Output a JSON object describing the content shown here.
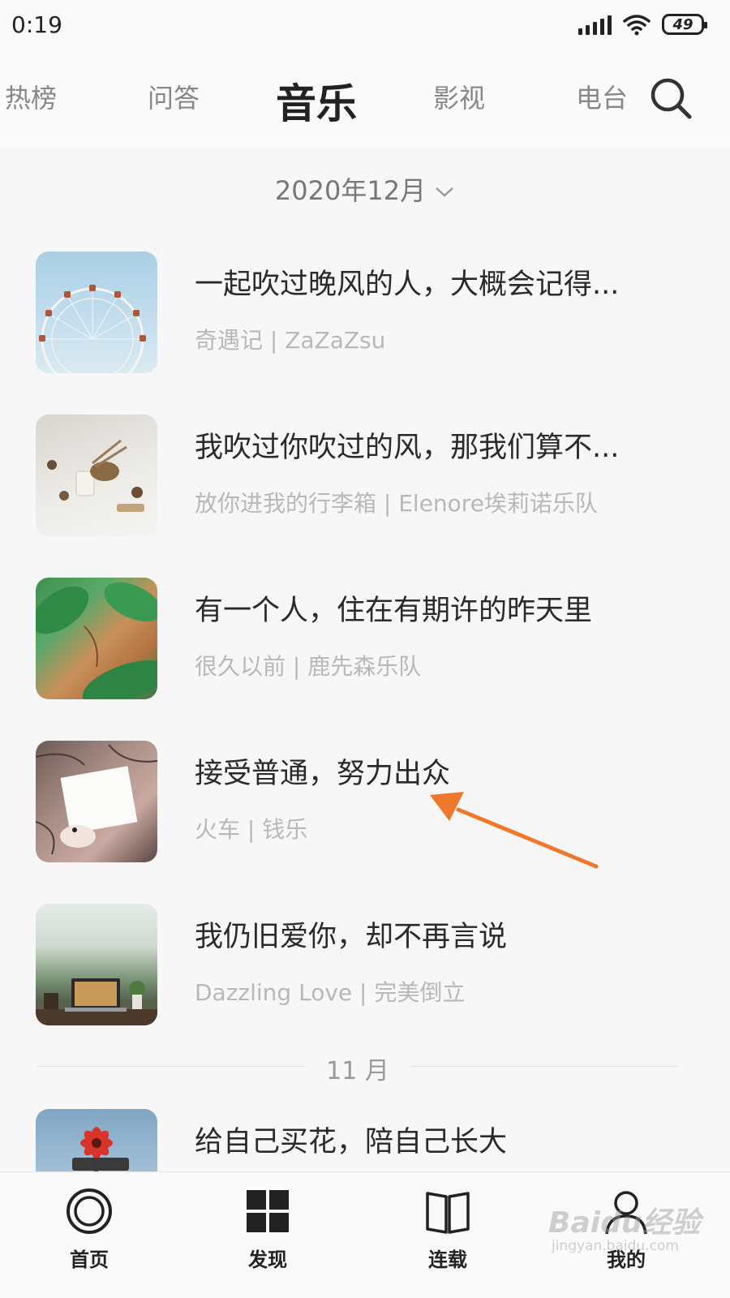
{
  "status_bar": {
    "time": "0:19",
    "battery": "49"
  },
  "top_tabs": [
    {
      "label": "热榜",
      "active": false
    },
    {
      "label": "问答",
      "active": false
    },
    {
      "label": "音乐",
      "active": true
    },
    {
      "label": "影视",
      "active": false
    },
    {
      "label": "电台",
      "active": false
    }
  ],
  "month_selector": {
    "label": "2020年12月"
  },
  "songs": [
    {
      "title": "一起吹过晚风的人，大概会记得...",
      "meta": "奇遇记 | ZaZaZsu"
    },
    {
      "title": "我吹过你吹过的风，那我们算不...",
      "meta": "放你进我的行李箱 | Elenore埃莉诺乐队"
    },
    {
      "title": "有一个人，住在有期许的昨天里",
      "meta": "很久以前 | 鹿先森乐队"
    },
    {
      "title": "接受普通，努力出众",
      "meta": "火车 | 钱乐"
    },
    {
      "title": "我仍旧爱你，却不再言说",
      "meta": "Dazzling Love | 完美倒立"
    },
    {
      "title": "给自己买花，陪自己长大",
      "meta": ""
    }
  ],
  "section_divider": {
    "label": "11 月"
  },
  "bottom_nav": [
    {
      "label": "首页",
      "icon": "home-ring-icon"
    },
    {
      "label": "发现",
      "icon": "grid-icon"
    },
    {
      "label": "连载",
      "icon": "book-icon"
    },
    {
      "label": "我的",
      "icon": "user-icon"
    }
  ],
  "watermark": {
    "main": "Baidu经验",
    "sub": "jingyan.baidu.com"
  },
  "colors": {
    "annotation_arrow": "#f0782c",
    "active_tab": "#222222",
    "inactive_tab": "#888888",
    "meta_text": "#b8b8b8"
  }
}
